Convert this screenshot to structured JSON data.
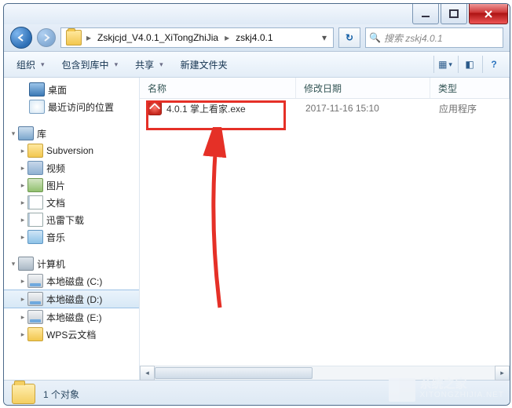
{
  "titlebar": {},
  "nav": {
    "crumbs": [
      "Zskjcjd_V4.0.1_XiTongZhiJia",
      "zskj4.0.1"
    ],
    "search_placeholder": "搜索 zskj4.0.1"
  },
  "toolbar": {
    "organize": "组织",
    "include": "包含到库中",
    "share": "共享",
    "newfolder": "新建文件夹"
  },
  "tree": {
    "desktop": "桌面",
    "recent": "最近访问的位置",
    "libraries": "库",
    "subversion": "Subversion",
    "videos": "视频",
    "pictures": "图片",
    "documents": "文档",
    "xunlei": "迅雷下载",
    "music": "音乐",
    "computer": "计算机",
    "disk_c": "本地磁盘 (C:)",
    "disk_d": "本地磁盘 (D:)",
    "disk_e": "本地磁盘 (E:)",
    "wps": "WPS云文档"
  },
  "columns": {
    "name": "名称",
    "date": "修改日期",
    "type": "类型"
  },
  "files": [
    {
      "name": "4.0.1 掌上看家.exe",
      "date": "2017-11-16 15:10",
      "type": "应用程序"
    }
  ],
  "status": {
    "count_text": "1 个对象"
  },
  "watermark": {
    "line1": "系统之家",
    "line2": "XITONGZHIJIA.NET"
  }
}
